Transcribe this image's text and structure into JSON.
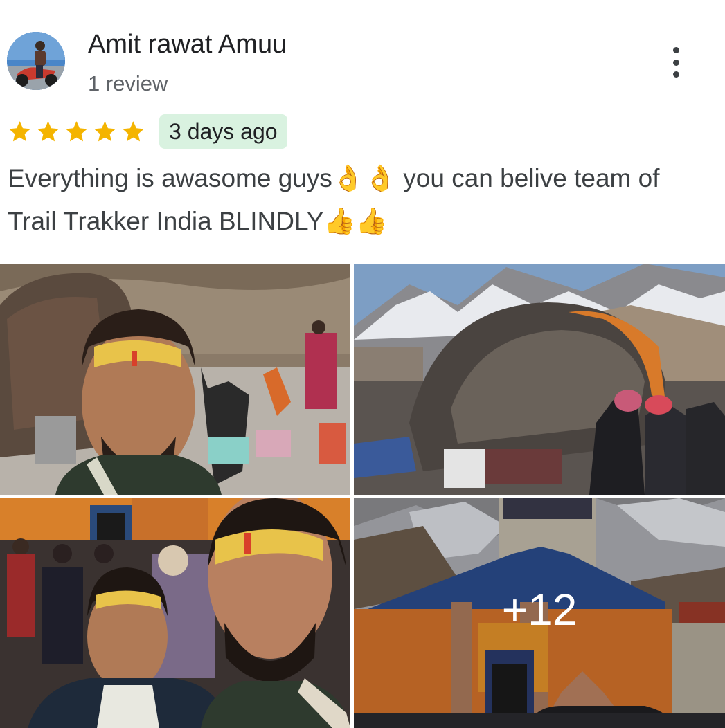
{
  "reviewer": {
    "name": "Amit rawat Amuu",
    "review_count": "1 review",
    "avatar_icon": "avatar-photo"
  },
  "menu": {
    "icon": "more-vert-icon"
  },
  "rating": {
    "stars": 5,
    "max_stars": 5,
    "star_color": "#f4b400",
    "time_ago": "3 days ago",
    "time_badge_color": "#d9f2e0"
  },
  "review": {
    "text": "Everything is awasome guys👌👌 you can belive team of Trail Trakker India BLINDLY👍👍"
  },
  "photos": {
    "more_count": "+12",
    "items": [
      {
        "icon": "photo-selfie-rock"
      },
      {
        "icon": "photo-rock-mountain"
      },
      {
        "icon": "photo-selfie-crowd"
      },
      {
        "icon": "photo-temple"
      }
    ]
  }
}
